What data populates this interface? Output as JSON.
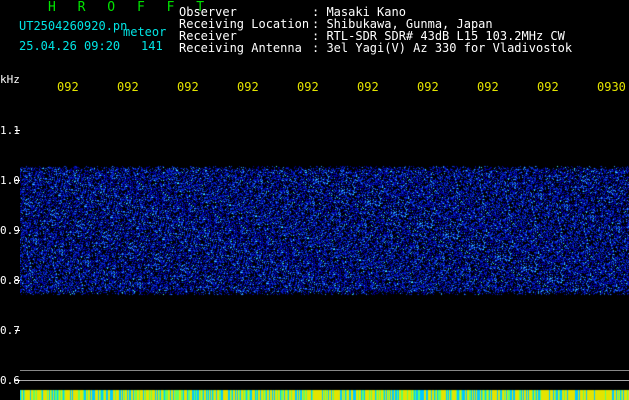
{
  "header": {
    "title": "H R O F F T",
    "filename": "UT2504260920.pn",
    "subtitle": "meteor",
    "datetime": "25.04.26 09:20",
    "count": "141",
    "fields": [
      {
        "label": "Observer",
        "value": ": Masaki Kano"
      },
      {
        "label": "Receiving Location",
        "value": ": Shibukawa, Gunma, Japan"
      },
      {
        "label": "Receiver",
        "value": ": RTL-SDR SDR# 43dB L15 103.2MHz CW"
      },
      {
        "label": "Receiving Antenna",
        "value": ": 3el Yagi(V) Az 330 for Vladivostok"
      }
    ]
  },
  "axis": {
    "unit": "kHz",
    "y_ticks": [
      "1.1",
      "1.0",
      "0.9",
      "0.8",
      "0.7",
      "0.6"
    ],
    "x_ticks": [
      "092",
      "092",
      "092",
      "092",
      "092",
      "092",
      "092",
      "092",
      "092",
      "0930"
    ]
  },
  "colors": {
    "noise_dark": "#0000a0",
    "noise_light": "#2ea0ff",
    "noise_speck": "#40ffff",
    "bottom_strip": "#e4e400"
  },
  "spectrogram": {
    "band_top_khz": 1.02,
    "band_bottom_khz": 0.78
  }
}
